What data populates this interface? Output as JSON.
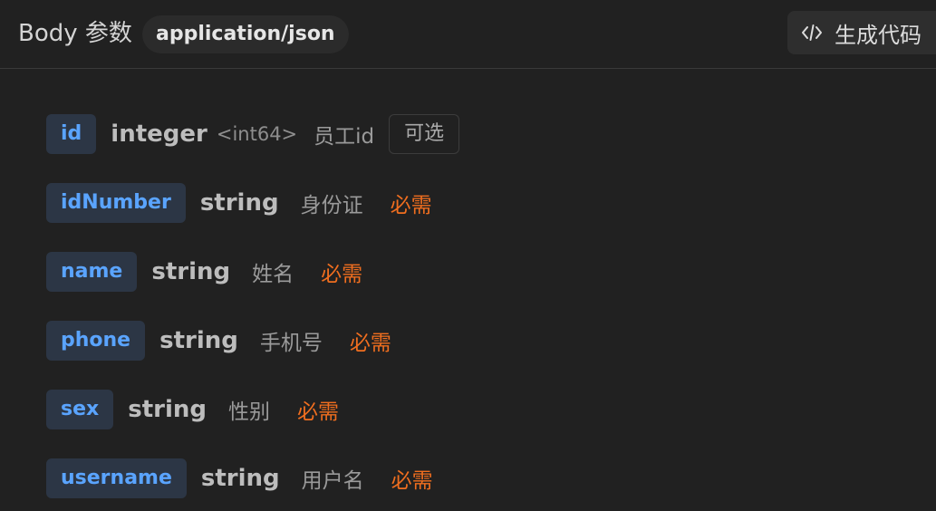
{
  "header": {
    "title": "Body 参数",
    "content_type": "application/json",
    "generate_code_label": "生成代码",
    "generate_code_icon": "code-brackets-icon"
  },
  "params": [
    {
      "name": "id",
      "type": "integer",
      "format": "<int64>",
      "description": "员工id",
      "status": "可选"
    },
    {
      "name": "idNumber",
      "type": "string",
      "description": "身份证",
      "status": "必需"
    },
    {
      "name": "name",
      "type": "string",
      "description": "姓名",
      "status": "必需"
    },
    {
      "name": "phone",
      "type": "string",
      "description": "手机号",
      "status": "必需"
    },
    {
      "name": "sex",
      "type": "string",
      "description": "性别",
      "status": "必需"
    },
    {
      "name": "username",
      "type": "string",
      "description": "用户名",
      "status": "必需"
    }
  ],
  "colors": {
    "background": "#212121",
    "param_name_text": "#5aa4ff",
    "param_name_bg": "#2c3645",
    "required": "#f06e1f"
  }
}
